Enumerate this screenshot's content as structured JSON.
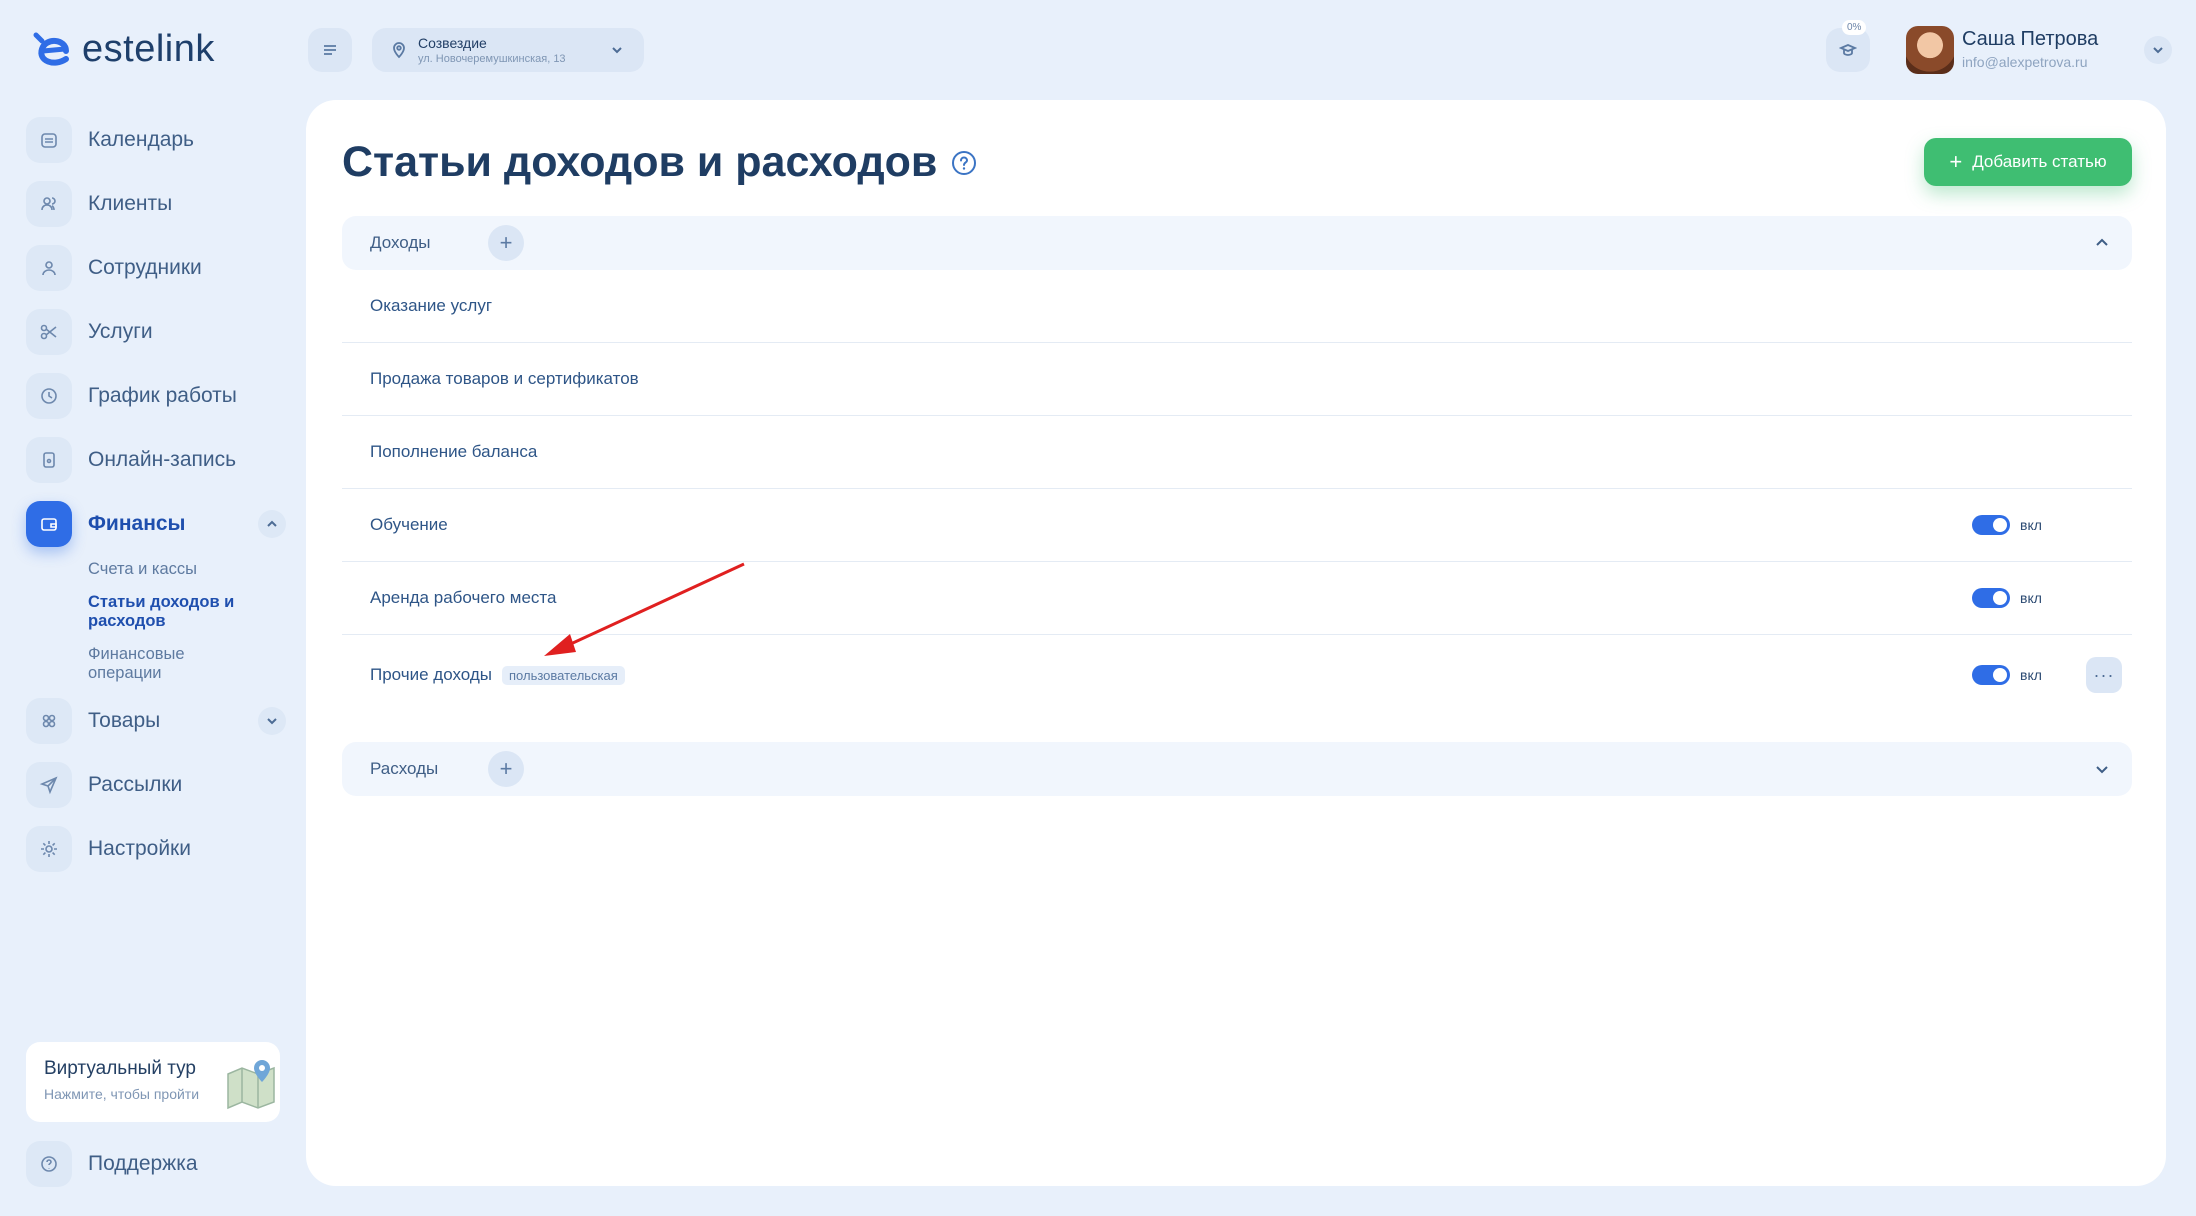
{
  "brand": {
    "name": "estelink"
  },
  "sidebar": {
    "items": [
      {
        "label": "Календарь",
        "icon": "calendar-icon"
      },
      {
        "label": "Клиенты",
        "icon": "clients-icon"
      },
      {
        "label": "Сотрудники",
        "icon": "employee-icon"
      },
      {
        "label": "Услуги",
        "icon": "scissors-icon"
      },
      {
        "label": "График работы",
        "icon": "clock-icon"
      },
      {
        "label": "Онлайн-запись",
        "icon": "phone-icon"
      },
      {
        "label": "Финансы",
        "icon": "wallet-icon"
      },
      {
        "label": "Товары",
        "icon": "products-icon"
      },
      {
        "label": "Рассылки",
        "icon": "send-icon"
      },
      {
        "label": "Настройки",
        "icon": "gear-icon"
      }
    ],
    "finance_sub": [
      "Счета и кассы",
      "Статьи доходов и расходов",
      "Финансовые операции"
    ],
    "tour": {
      "title": "Виртуальный тур",
      "subtitle": "Нажмите, чтобы пройти"
    },
    "support": "Поддержка"
  },
  "header": {
    "location_name": "Созвездие",
    "location_address": "ул. Новочеремушкинская, 13",
    "progress": "0%",
    "user_name": "Саша Петрова",
    "user_email": "info@alexpetrova.ru"
  },
  "main": {
    "title": "Статьи доходов и расходов",
    "add_button": "Добавить статью",
    "income": {
      "title": "Доходы",
      "rows": [
        {
          "label": "Оказание услуг"
        },
        {
          "label": "Продажа товаров и сертификатов"
        },
        {
          "label": "Пополнение баланса"
        },
        {
          "label": "Обучение",
          "toggle": "вкл"
        },
        {
          "label": "Аренда рабочего места",
          "toggle": "вкл"
        },
        {
          "label": "Прочие доходы",
          "tag": "пользовательская",
          "toggle": "вкл"
        }
      ]
    },
    "expenses": {
      "title": "Расходы"
    }
  },
  "colors": {
    "accent": "#2f6de6",
    "success": "#3fbe72",
    "annotation": "#e02020"
  }
}
